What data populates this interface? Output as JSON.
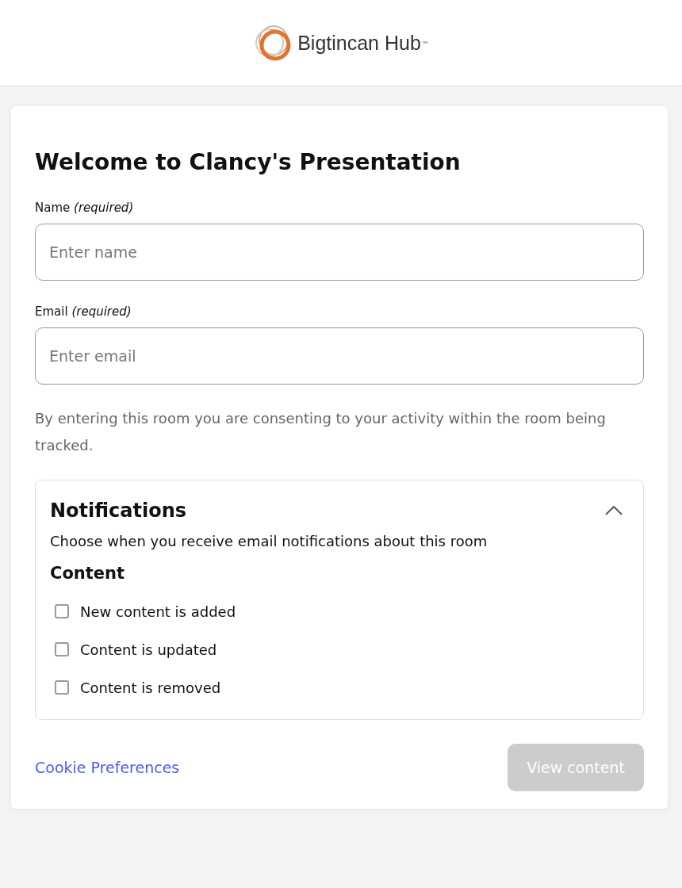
{
  "header": {
    "logo_text": "Bigtincan Hub",
    "trademark": "™"
  },
  "form": {
    "title": "Welcome to Clancy's Presentation",
    "fields": [
      {
        "label": "Name *(required)*",
        "placeholder": "Enter name"
      },
      {
        "label": "Email *(required)*",
        "placeholder": "Enter email"
      }
    ],
    "consent": "By entering this room you are consenting to your activity within the room being tracked.",
    "notifications": {
      "title": "Notifications",
      "expanded": true,
      "description": "Choose when you receive email notifications about this room",
      "group": "Content",
      "options": [
        {
          "label": "New content is added",
          "checked": false
        },
        {
          "label": "Content is updated",
          "checked": false
        },
        {
          "label": "Content is removed",
          "checked": false
        }
      ]
    },
    "cookie_link": "Cookie Preferences",
    "submit": {
      "label": "View content",
      "disabled": true
    }
  }
}
